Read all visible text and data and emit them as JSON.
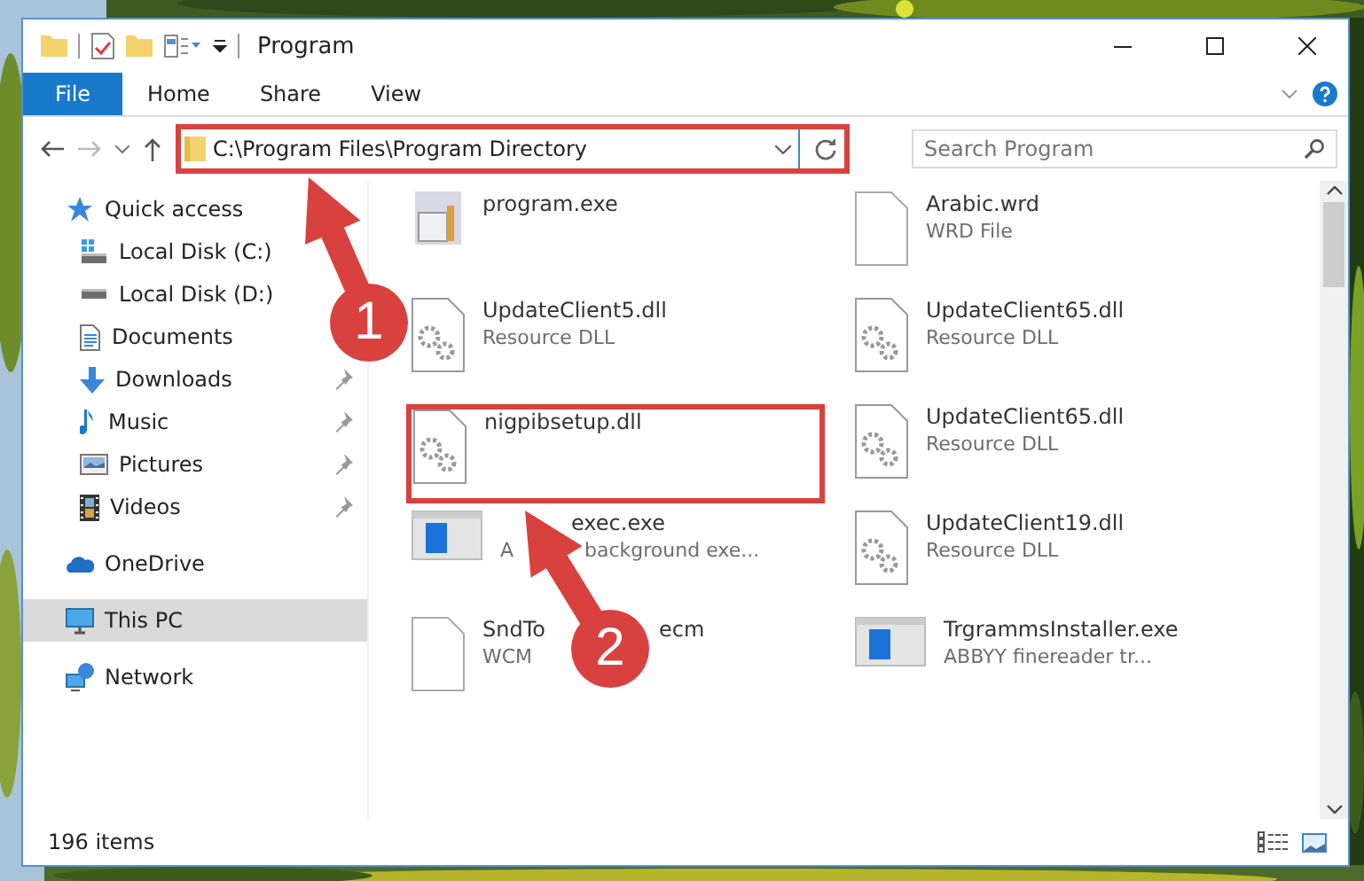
{
  "window": {
    "title": "Program"
  },
  "ribbon_tabs": [
    {
      "label": "File",
      "kind": "file"
    },
    {
      "label": "Home",
      "kind": "tab"
    },
    {
      "label": "Share",
      "kind": "tab"
    },
    {
      "label": "View",
      "kind": "tab"
    }
  ],
  "address_bar": {
    "path": "C:\\Program Files\\Program Directory",
    "highlighted": true
  },
  "search": {
    "placeholder": "Search Program"
  },
  "sidebar": {
    "items": [
      {
        "label": "Quick access",
        "kind": "quickaccess",
        "selected": false,
        "children": [
          {
            "label": "Local Disk (C:)",
            "kind": "systemdrive",
            "selected": false
          },
          {
            "label": "Local Disk (D:)",
            "kind": "drive",
            "selected": false
          },
          {
            "label": "Documents",
            "kind": "documents",
            "selected": false
          },
          {
            "label": "Downloads",
            "kind": "downloads",
            "pinned": true,
            "selected": false
          },
          {
            "label": "Music",
            "kind": "music",
            "pinned": true,
            "selected": false
          },
          {
            "label": "Pictures",
            "kind": "pictures",
            "pinned": true,
            "selected": false
          },
          {
            "label": "Videos",
            "kind": "videos",
            "pinned": true,
            "selected": false
          }
        ]
      },
      {
        "label": "OneDrive",
        "kind": "onedrive",
        "selected": false
      },
      {
        "label": "This PC",
        "kind": "pc",
        "selected": true
      },
      {
        "label": "Network",
        "kind": "network",
        "selected": false
      }
    ]
  },
  "files": [
    {
      "name": [
        "program.exe"
      ],
      "kind": "program",
      "highlighted": false
    },
    {
      "name": [
        "Arabic.wrd"
      ],
      "type": [
        "WRD File"
      ],
      "kind": "document",
      "highlighted": false
    },
    {
      "name": [
        "UpdateClient5.dll"
      ],
      "type": [
        "Resource DLL"
      ],
      "kind": "library",
      "highlighted": false
    },
    {
      "name": [
        "UpdateClient65.dll"
      ],
      "type": [
        "Resource DLL"
      ],
      "kind": "library",
      "highlighted": false
    },
    {
      "name": [
        "nigpibsetup.dll"
      ],
      "kind": "library",
      "highlighted": true
    },
    {
      "name": [
        "UpdateClient65.dll"
      ],
      "type": [
        "Resource DLL"
      ],
      "kind": "library",
      "highlighted": false
    },
    {
      "name": [
        "exec.exe"
      ],
      "type": [
        "A",
        "background exe..."
      ],
      "kind": "application",
      "highlighted": false
    },
    {
      "name": [
        "UpdateClient19.dll"
      ],
      "type": [
        "Resource DLL"
      ],
      "kind": "library",
      "highlighted": false
    },
    {
      "name": [
        "SndTo",
        "ecm"
      ],
      "type": [
        "WCM"
      ],
      "kind": "document",
      "highlighted": false
    },
    {
      "name": [
        "TrgrammsInstaller.exe"
      ],
      "type": [
        "ABBYY finereader tr..."
      ],
      "kind": "application",
      "highlighted": false
    }
  ],
  "status_bar": {
    "item_count": "196 items"
  },
  "annotations": [
    {
      "label": "1"
    },
    {
      "label": "2"
    }
  ]
}
